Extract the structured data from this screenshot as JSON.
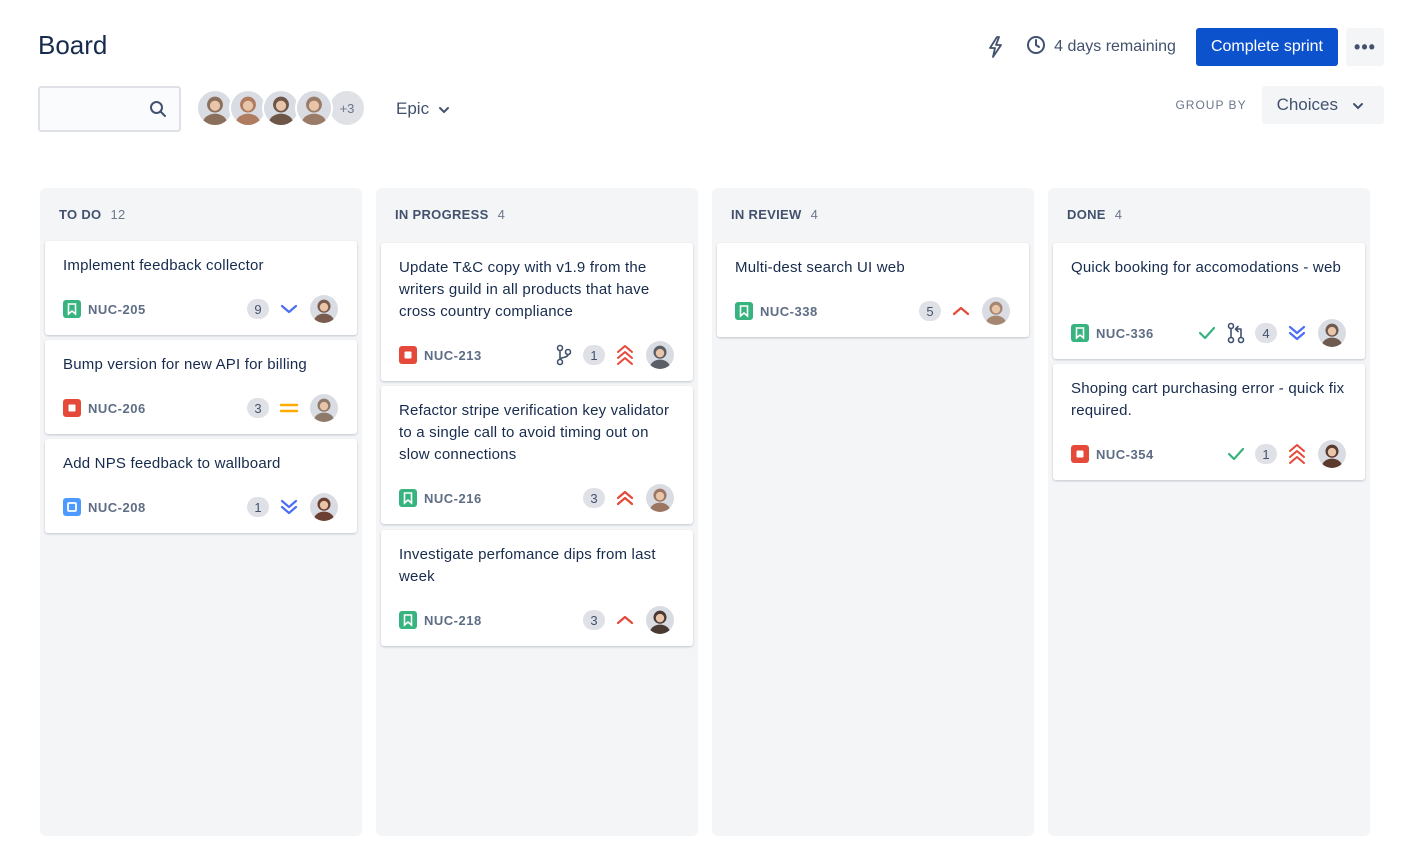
{
  "header": {
    "title": "Board",
    "time_remaining": "4 days remaining",
    "complete_label": "Complete sprint",
    "more_label": "•••"
  },
  "toolbar": {
    "search_placeholder": "",
    "avatars": [
      "#8a6f5c",
      "#b07c5f",
      "#6d5548",
      "#9a7b68"
    ],
    "more_avatars": "+3",
    "epic_label": "Epic",
    "group_by_label": "GROUP BY",
    "group_by_value": "Choices"
  },
  "colors": {
    "story": "#36b37e",
    "bug": "#e5493a",
    "task": "#4c9aff",
    "primary": "#0c52cc",
    "priority_high": "#e5493a",
    "priority_low": "#4c6ef5",
    "priority_medium": "#ffab00"
  },
  "columns": [
    {
      "title": "TO DO",
      "count": "12",
      "cards": [
        {
          "title": "Implement feedback collector",
          "key": "NUC-205",
          "type": "story",
          "estimate": "9",
          "priority": "low",
          "avatar": "#7a5c4e"
        },
        {
          "title": "Bump version for new API for billing",
          "key": "NUC-206",
          "type": "bug",
          "estimate": "3",
          "priority": "medium",
          "avatar": "#8d7a6a"
        },
        {
          "title": "Add NPS feedback to wallboard",
          "key": "NUC-208",
          "type": "task",
          "estimate": "1",
          "priority": "lowest",
          "avatar": "#6b3f32"
        }
      ]
    },
    {
      "title": "IN PROGRESS",
      "count": "4",
      "cards": [
        {
          "title": "Update T&C copy with v1.9 from the writers guild in all products that have cross country compliance",
          "key": "NUC-213",
          "type": "bug",
          "branch": "branch",
          "estimate": "1",
          "priority": "highest",
          "avatar": "#5a5f66"
        },
        {
          "title": "Refactor stripe verification key validator to a single call to avoid timing out on slow connections",
          "key": "NUC-216",
          "type": "story",
          "estimate": "3",
          "priority": "highest2",
          "avatar": "#9c7662"
        },
        {
          "title": "Investigate perfomance dips from last week",
          "key": "NUC-218",
          "type": "story",
          "estimate": "3",
          "priority": "high",
          "avatar": "#4a3a33"
        }
      ]
    },
    {
      "title": "IN REVIEW",
      "count": "4",
      "cards": [
        {
          "title": "Multi-dest search UI web",
          "key": "NUC-338",
          "type": "story",
          "estimate": "5",
          "priority": "high",
          "avatar": "#a58670"
        }
      ]
    },
    {
      "title": "DONE",
      "count": "4",
      "cards": [
        {
          "title": "Quick booking for accomodations - web",
          "key": "NUC-336",
          "type": "story",
          "done": true,
          "pr": true,
          "estimate": "4",
          "priority": "lowest",
          "avatar": "#6e5a4f"
        },
        {
          "title": "Shoping cart purchasing error - quick fix required.",
          "key": "NUC-354",
          "type": "bug",
          "done": true,
          "estimate": "1",
          "priority": "highest",
          "avatar": "#5c3a2e"
        }
      ]
    }
  ]
}
